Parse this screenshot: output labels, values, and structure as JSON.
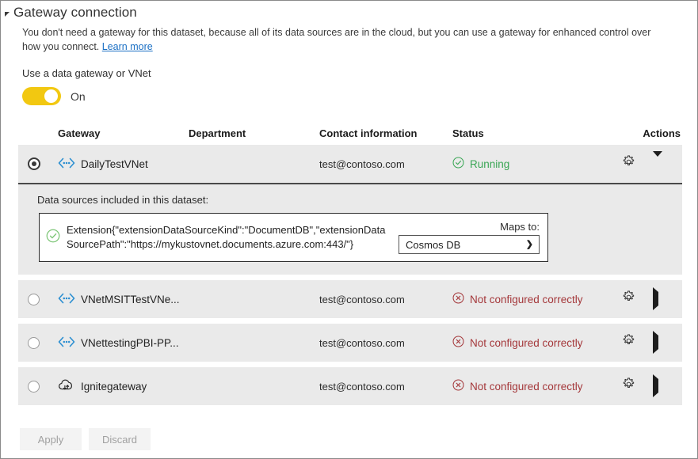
{
  "section": {
    "title": "Gateway connection",
    "collapse_icon": "triangle-expanded-icon",
    "description_part1": "You don't need a gateway for this dataset, because all of its data sources are in the cloud, but you can use a gateway for enhanced control over how you connect. ",
    "learn_more": "Learn more",
    "subheading": "Use a data gateway or VNet"
  },
  "toggle": {
    "state_label": "On",
    "on": true,
    "accent_color": "#f2c811"
  },
  "table": {
    "headers": {
      "gateway": "Gateway",
      "department": "Department",
      "contact": "Contact information",
      "status": "Status",
      "actions": "Actions"
    },
    "rows": [
      {
        "selected": true,
        "icon": "vnet-icon",
        "name": "DailyTestVNet",
        "department": "",
        "contact": "test@contoso.com",
        "status": "Running",
        "status_kind": "ok",
        "status_icon": "check-circle-icon",
        "status_color": "#3aa655",
        "expanded": true,
        "chevron": "chevron-down-icon"
      },
      {
        "selected": false,
        "icon": "vnet-icon",
        "name": "VNetMSITTestVNe...",
        "department": "",
        "contact": "test@contoso.com",
        "status": "Not configured correctly",
        "status_kind": "err",
        "status_icon": "error-circle-icon",
        "status_color": "#a4373a",
        "expanded": false,
        "chevron": "chevron-right-icon"
      },
      {
        "selected": false,
        "icon": "vnet-icon",
        "name": "VNettestingPBI-PP...",
        "department": "",
        "contact": "test@contoso.com",
        "status": "Not configured correctly",
        "status_kind": "err",
        "status_icon": "error-circle-icon",
        "status_color": "#a4373a",
        "expanded": false,
        "chevron": "chevron-right-icon"
      },
      {
        "selected": false,
        "icon": "cloud-gateway-icon",
        "name": "Ignitegateway",
        "department": "",
        "contact": "test@contoso.com",
        "status": "Not configured correctly",
        "status_kind": "err",
        "status_icon": "error-circle-icon",
        "status_color": "#a4373a",
        "expanded": false,
        "chevron": "chevron-right-icon"
      }
    ]
  },
  "detail": {
    "label": "Data sources included in this dataset:",
    "source_status_icon": "check-circle-icon",
    "source_text": "Extension{\"extensionDataSourceKind\":\"DocumentDB\",\"extensionDataSourcePath\":\"https://mykustovnet.documents.azure.com:443/\"}",
    "maps_to_label": "Maps to:",
    "maps_to_value": "Cosmos DB"
  },
  "footer": {
    "apply": "Apply",
    "discard": "Discard"
  }
}
